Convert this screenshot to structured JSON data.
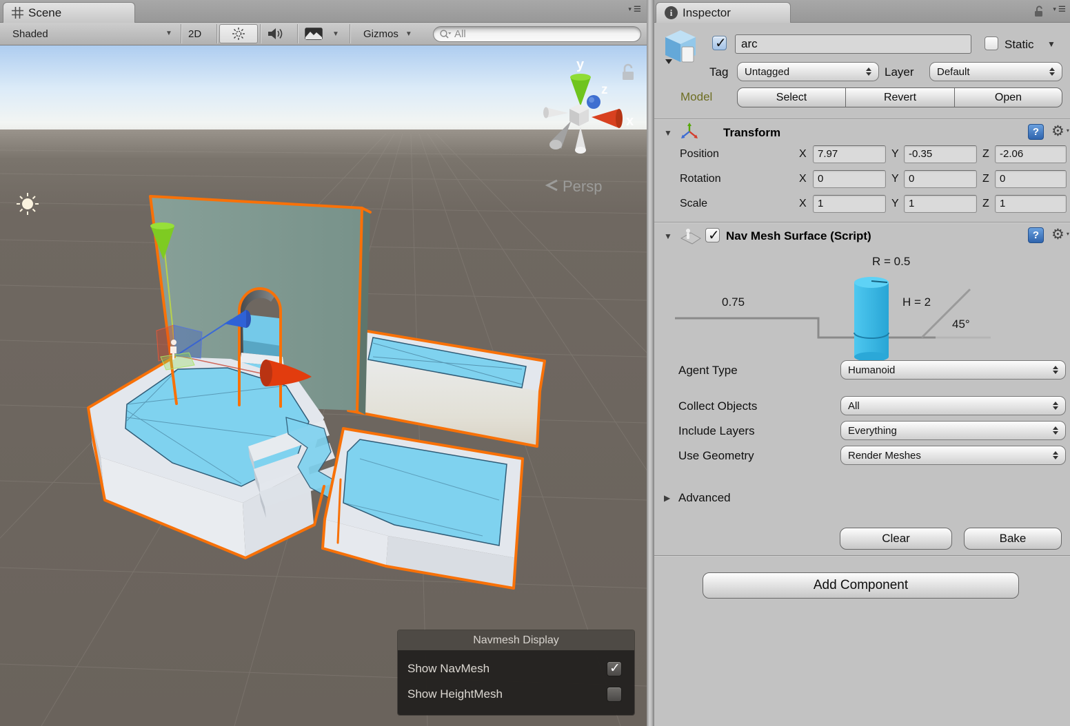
{
  "scene": {
    "tab_label": "Scene",
    "toolbar": {
      "shading": "Shaded",
      "toggle_2d": "2D",
      "gizmos": "Gizmos",
      "search_text": "All"
    },
    "viewport": {
      "projection_label": "Persp",
      "axis_labels": {
        "x": "x",
        "y": "y",
        "z": "z"
      }
    },
    "navmesh_overlay": {
      "title": "Navmesh Display",
      "items": [
        {
          "label": "Show NavMesh",
          "checked": true
        },
        {
          "label": "Show HeightMesh",
          "checked": false
        }
      ]
    }
  },
  "inspector": {
    "tab_label": "Inspector",
    "game_object": {
      "name": "arc",
      "static_label": "Static",
      "tag_label": "Tag",
      "tag_value": "Untagged",
      "layer_label": "Layer",
      "layer_value": "Default",
      "model_label": "Model",
      "model_buttons": {
        "select": "Select",
        "revert": "Revert",
        "open": "Open"
      }
    },
    "transform": {
      "title": "Transform",
      "axis": {
        "x": "X",
        "y": "Y",
        "z": "Z"
      },
      "position": {
        "label": "Position",
        "x": "7.97",
        "y": "-0.35",
        "z": "-2.06"
      },
      "rotation": {
        "label": "Rotation",
        "x": "0",
        "y": "0",
        "z": "0"
      },
      "scale": {
        "label": "Scale",
        "x": "1",
        "y": "1",
        "z": "1"
      }
    },
    "navmesh_surface": {
      "title": "Nav Mesh Surface (Script)",
      "diagram": {
        "radius": "R = 0.5",
        "height": "H = 2",
        "step": "0.75",
        "slope": "45°"
      },
      "agent_type": {
        "label": "Agent Type",
        "value": "Humanoid"
      },
      "collect_objects": {
        "label": "Collect Objects",
        "value": "All"
      },
      "include_layers": {
        "label": "Include Layers",
        "value": "Everything"
      },
      "use_geometry": {
        "label": "Use Geometry",
        "value": "Render Meshes"
      },
      "advanced_label": "Advanced",
      "clear_button": "Clear",
      "bake_button": "Bake"
    },
    "add_component_button": "Add Component"
  },
  "colors": {
    "accent_orange": "#f87108",
    "navmesh_blue": "#7fd2ef",
    "wall_green": "#7d968e",
    "ground": "#6e6760",
    "sky_top": "#b0d0f0"
  }
}
